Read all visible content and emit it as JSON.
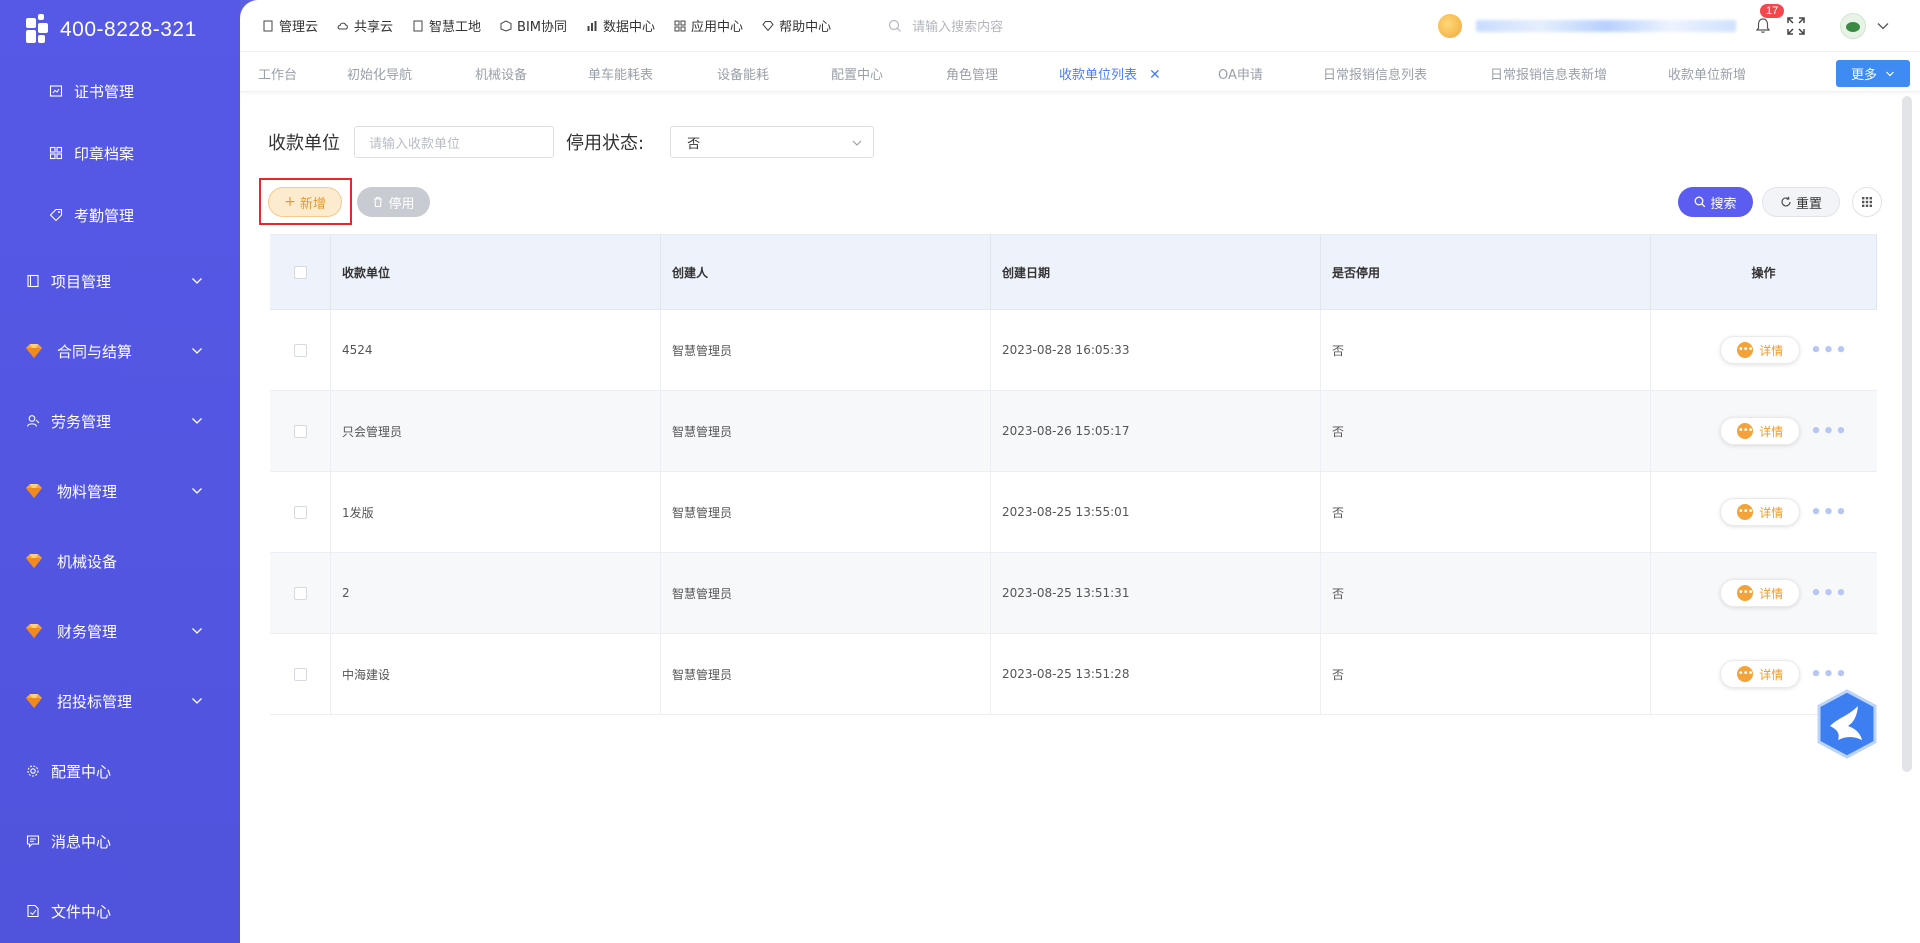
{
  "brand": {
    "phone": "400-8228-321"
  },
  "sidebar": {
    "items": [
      {
        "label": "证书管理",
        "icon": "certificate-icon",
        "sub": true
      },
      {
        "label": "印章档案",
        "icon": "grid-icon",
        "sub": true
      },
      {
        "label": "考勤管理",
        "icon": "tag-icon",
        "sub": true
      },
      {
        "label": "项目管理",
        "icon": "book-icon",
        "expandable": true
      },
      {
        "label": "合同与结算",
        "icon": "gem-icon",
        "expandable": true
      },
      {
        "label": "劳务管理",
        "icon": "user-icon",
        "expandable": true
      },
      {
        "label": "物料管理",
        "icon": "gem-icon",
        "expandable": true
      },
      {
        "label": "机械设备",
        "icon": "gem-icon",
        "expandable": false
      },
      {
        "label": "财务管理",
        "icon": "gem-icon",
        "expandable": true
      },
      {
        "label": "招投标管理",
        "icon": "gem-icon",
        "expandable": true
      },
      {
        "label": "配置中心",
        "icon": "gear-icon",
        "expandable": false
      },
      {
        "label": "消息中心",
        "icon": "message-icon",
        "expandable": false
      },
      {
        "label": "文件中心",
        "icon": "file-icon",
        "expandable": false
      }
    ]
  },
  "topnav": {
    "items": [
      "管理云",
      "共享云",
      "智慧工地",
      "BIM协同",
      "数据中心",
      "应用中心",
      "帮助中心"
    ],
    "search_placeholder": "请输入搜索内容",
    "notification_count": "17"
  },
  "tabs": {
    "items": [
      "工作台",
      "初始化导航",
      "机械设备",
      "单车能耗表",
      "设备能耗",
      "配置中心",
      "角色管理",
      "收款单位列表",
      "OA申请",
      "日常报销信息列表",
      "日常报销信息表新增",
      "收款单位新增"
    ],
    "active_index": 7,
    "more_label": "更多"
  },
  "filters": {
    "payee_label": "收款单位",
    "payee_placeholder": "请输入收款单位",
    "status_label": "停用状态:",
    "status_value": "否"
  },
  "actions": {
    "add_label": "新增",
    "disable_label": "停用",
    "search_label": "搜索",
    "reset_label": "重置"
  },
  "table": {
    "columns": [
      "收款单位",
      "创建人",
      "创建日期",
      "是否停用",
      "操作"
    ],
    "rows": [
      {
        "payee": "4524",
        "creator": "智慧管理员",
        "date": "2023-08-28 16:05:33",
        "disabled": "否"
      },
      {
        "payee": "只会管理员",
        "creator": "智慧管理员",
        "date": "2023-08-26 15:05:17",
        "disabled": "否"
      },
      {
        "payee": "1发版",
        "creator": "智慧管理员",
        "date": "2023-08-25 13:55:01",
        "disabled": "否"
      },
      {
        "payee": "2",
        "creator": "智慧管理员",
        "date": "2023-08-25 13:51:31",
        "disabled": "否"
      },
      {
        "payee": "中海建设",
        "creator": "智慧管理员",
        "date": "2023-08-25 13:51:28",
        "disabled": "否"
      }
    ],
    "detail_label": "详情"
  },
  "colors": {
    "sidebar": "#5559e6",
    "accent": "#5b5cf0",
    "tab_active": "#4a7df5",
    "add_button": "#e69a2e",
    "highlight": "#e32a2a"
  }
}
